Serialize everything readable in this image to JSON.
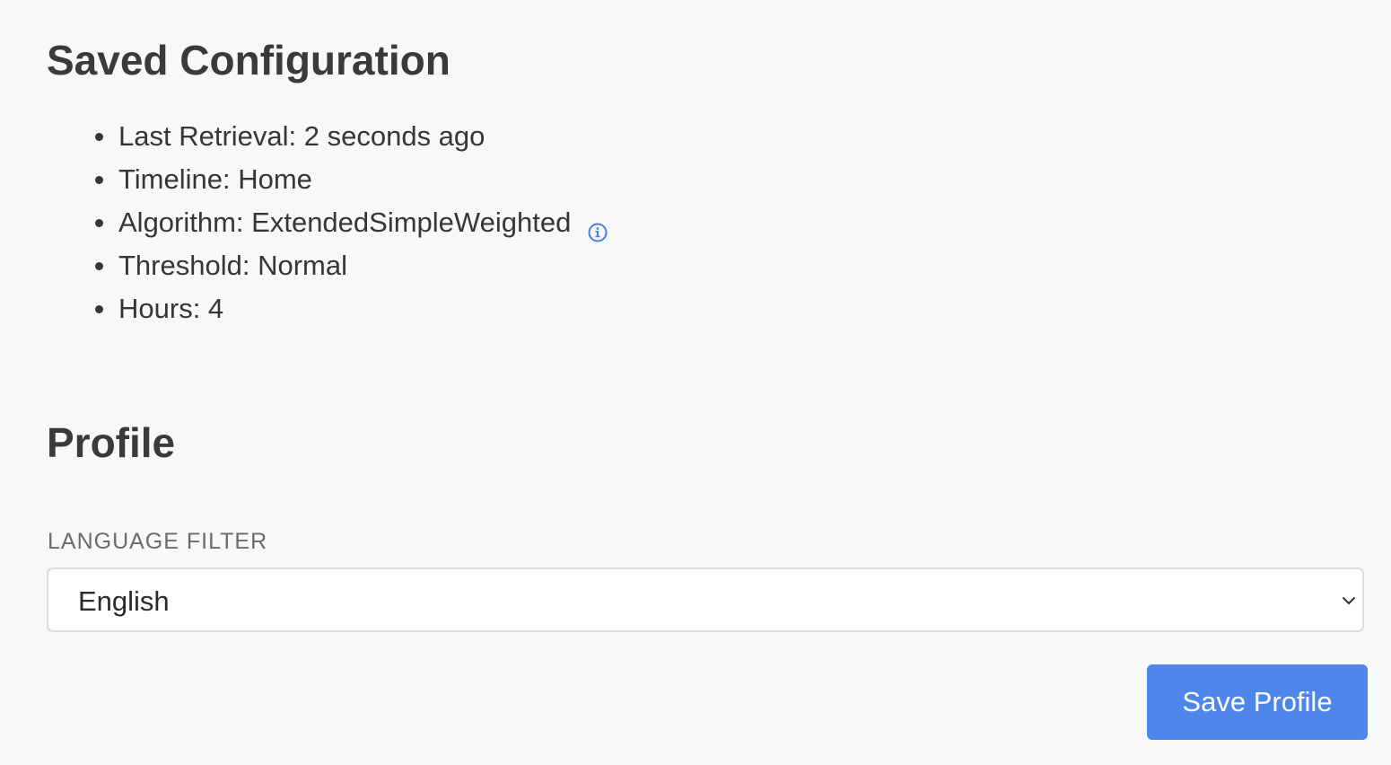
{
  "saved_configuration": {
    "title": "Saved Configuration",
    "items": [
      {
        "label": "Last Retrieval: 2 seconds ago"
      },
      {
        "label": "Timeline: Home"
      },
      {
        "label": "Algorithm: ExtendedSimpleWeighted",
        "icon": "info-icon"
      },
      {
        "label": "Threshold: Normal"
      },
      {
        "label": "Hours: 4"
      }
    ]
  },
  "profile": {
    "title": "Profile",
    "language_filter": {
      "label": "LANGUAGE FILTER",
      "selected": "English"
    },
    "save_label": "Save Profile"
  },
  "colors": {
    "accent": "#4f86ec",
    "info_icon": "#4a7fe0",
    "background": "#f8f8f8"
  }
}
